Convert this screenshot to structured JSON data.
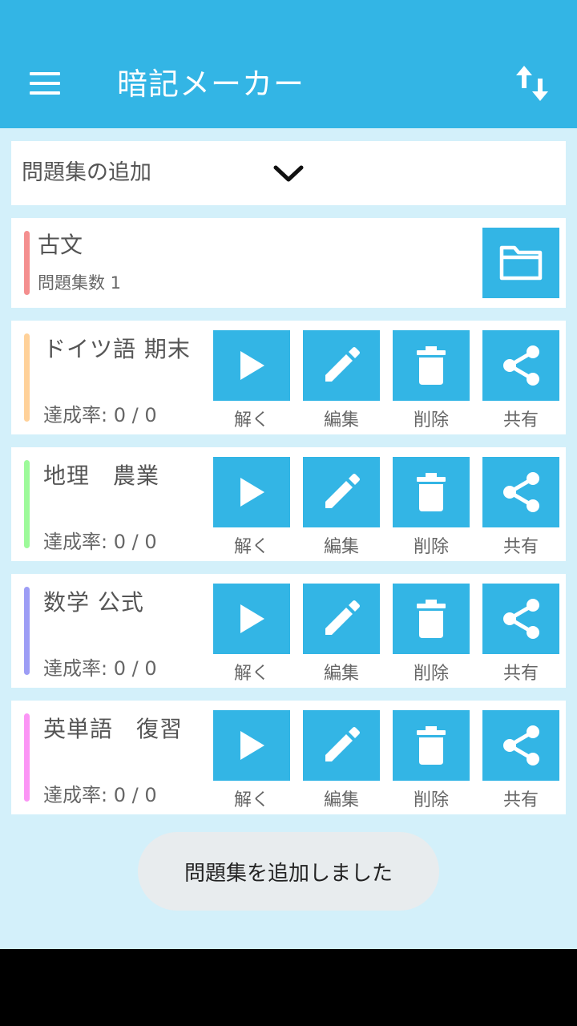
{
  "appbar": {
    "title": "暗記メーカー",
    "menu_icon": "hamburger-menu-icon",
    "sort_icon": "sort-arrows-icon"
  },
  "dropdown": {
    "label": "問題集の追加",
    "icon": "chevron-down-icon"
  },
  "folder": {
    "name": "古文",
    "count_label": "問題集数 1",
    "color": "#f48f8f",
    "icon": "folder-icon"
  },
  "actions": {
    "solve": "解く",
    "edit": "編集",
    "delete": "削除",
    "share": "共有"
  },
  "sets": [
    {
      "name": "ドイツ語 期末",
      "rate": "達成率: 0 / 0",
      "color": "#ffd199"
    },
    {
      "name": "地理　農業",
      "rate": "達成率: 0 / 0",
      "color": "#9dfa9a"
    },
    {
      "name": "数学 公式",
      "rate": "達成率: 0 / 0",
      "color": "#9d9df5"
    },
    {
      "name": "英単語　復習",
      "rate": "達成率: 0 / 0",
      "color": "#fb95f5"
    }
  ],
  "toast": {
    "message": "問題集を追加しました"
  },
  "colors": {
    "primary": "#33b5e5",
    "background": "#d3f0fa"
  }
}
